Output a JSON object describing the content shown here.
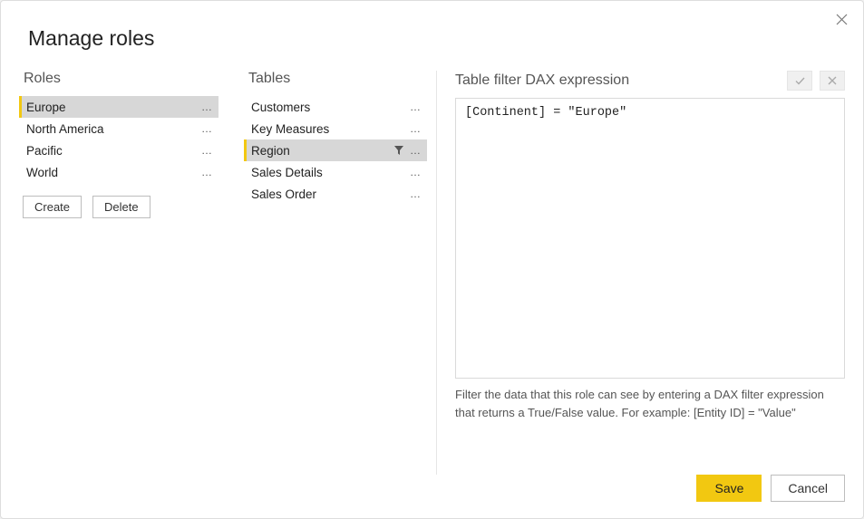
{
  "dialog": {
    "title": "Manage roles"
  },
  "roles": {
    "header": "Roles",
    "items": [
      {
        "label": "Europe",
        "selected": true
      },
      {
        "label": "North America",
        "selected": false
      },
      {
        "label": "Pacific",
        "selected": false
      },
      {
        "label": "World",
        "selected": false
      }
    ],
    "create_label": "Create",
    "delete_label": "Delete"
  },
  "tables": {
    "header": "Tables",
    "items": [
      {
        "label": "Customers",
        "selected": false,
        "filtered": false
      },
      {
        "label": "Key Measures",
        "selected": false,
        "filtered": false
      },
      {
        "label": "Region",
        "selected": true,
        "filtered": true
      },
      {
        "label": "Sales Details",
        "selected": false,
        "filtered": false
      },
      {
        "label": "Sales Order",
        "selected": false,
        "filtered": false
      }
    ]
  },
  "dax": {
    "header": "Table filter DAX expression",
    "expression": "[Continent] = \"Europe\"",
    "help": "Filter the data that this role can see by entering a DAX filter expression that returns a True/False value. For example: [Entity ID] = \"Value\""
  },
  "footer": {
    "save_label": "Save",
    "cancel_label": "Cancel"
  }
}
